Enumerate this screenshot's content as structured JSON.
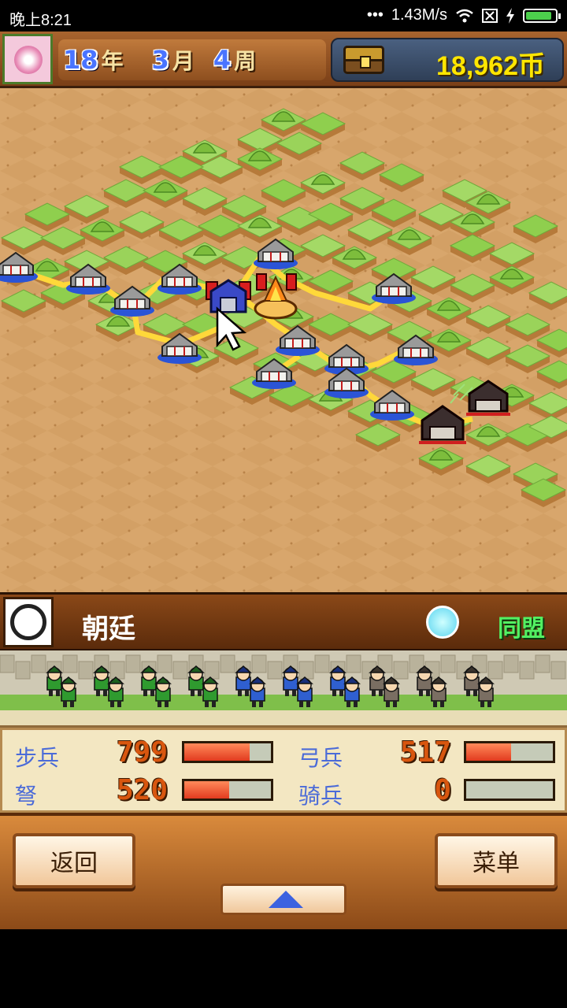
{
  "status_bar": {
    "time": "晚上8:21",
    "network_speed": "1.43M/s",
    "icons": [
      "signal-dots-icon",
      "wifi-icon",
      "sim-off-icon",
      "charging-icon",
      "battery-icon"
    ],
    "battery_level": 0.9
  },
  "hud": {
    "year": "18",
    "year_unit": "年",
    "month": "3",
    "month_unit": "月",
    "week": "4",
    "week_unit": "周",
    "money": "18,962币",
    "icons": [
      "cherry-blossom-avatar-icon",
      "treasure-chest-icon"
    ]
  },
  "faction": {
    "name": "朝廷",
    "relation": "同盟",
    "icons": [
      "crest-emblem-icon",
      "smiley-face-icon"
    ]
  },
  "stats": {
    "infantry": {
      "label": "步兵",
      "value": "799",
      "fill": 0.75
    },
    "archer": {
      "label": "弓兵",
      "value": "517",
      "fill": 0.52
    },
    "crossbow": {
      "label": "弩",
      "value": "520",
      "fill": 0.52
    },
    "cavalry": {
      "label": "骑兵",
      "value": "0",
      "fill": 0.0
    }
  },
  "buttons": {
    "back": "返回",
    "menu": "菜单",
    "expand_icon": "up-arrow-icon"
  },
  "colors": {
    "sand": "#d8a66c",
    "grass": "#8fcf4e",
    "road": "#ffd83a",
    "alliance_green": "#52f062",
    "stat_label_blue": "#4b6bd8",
    "stat_value_orange": "#d8560f"
  }
}
